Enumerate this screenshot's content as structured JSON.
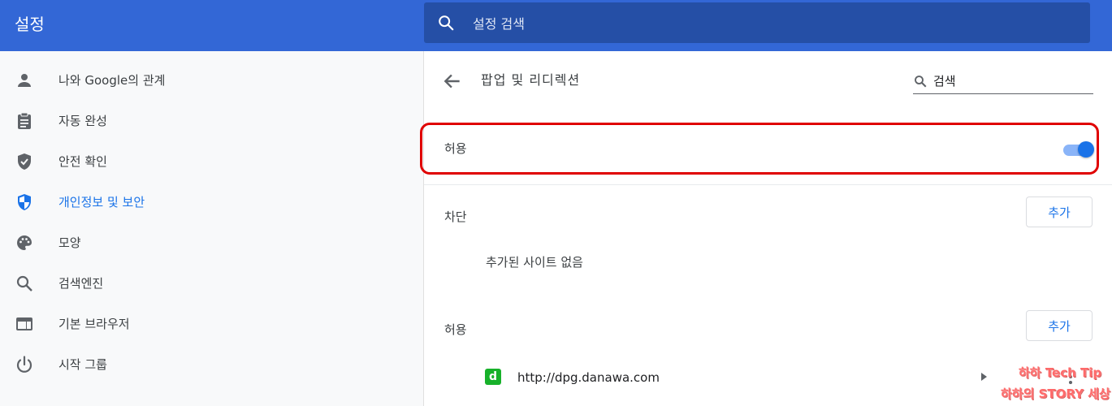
{
  "header": {
    "title": "설정",
    "search_placeholder": "설정 검색"
  },
  "sidebar": {
    "items": [
      {
        "label": "나와 Google의 관계",
        "icon": "person-icon"
      },
      {
        "label": "자동 완성",
        "icon": "clipboard-icon"
      },
      {
        "label": "안전 확인",
        "icon": "shield-check-icon"
      },
      {
        "label": "개인정보 및 보안",
        "icon": "security-shield-icon",
        "active": true
      },
      {
        "label": "모양",
        "icon": "palette-icon"
      },
      {
        "label": "검색엔진",
        "icon": "search-icon"
      },
      {
        "label": "기본 브라우저",
        "icon": "browser-icon"
      },
      {
        "label": "시작 그룹",
        "icon": "power-icon"
      }
    ]
  },
  "main": {
    "title": "팝업 및 리디렉션",
    "search_placeholder": "검색",
    "allow_toggle": {
      "label": "허용",
      "enabled": true
    },
    "block_section": {
      "label": "차단",
      "add_label": "추가",
      "empty_text": "추가된 사이트 없음"
    },
    "allow_section": {
      "label": "허용",
      "add_label": "추가",
      "sites": [
        {
          "favicon_letter": "d",
          "url": "http://dpg.danawa.com"
        }
      ]
    }
  },
  "watermark": {
    "line1": "하하 Tech Tip",
    "line2": "하하의 STORY 세상"
  },
  "colors": {
    "header": "#3367d6",
    "accent": "#1a73e8",
    "highlight": "#e00000",
    "favicon": "#17b12a"
  }
}
